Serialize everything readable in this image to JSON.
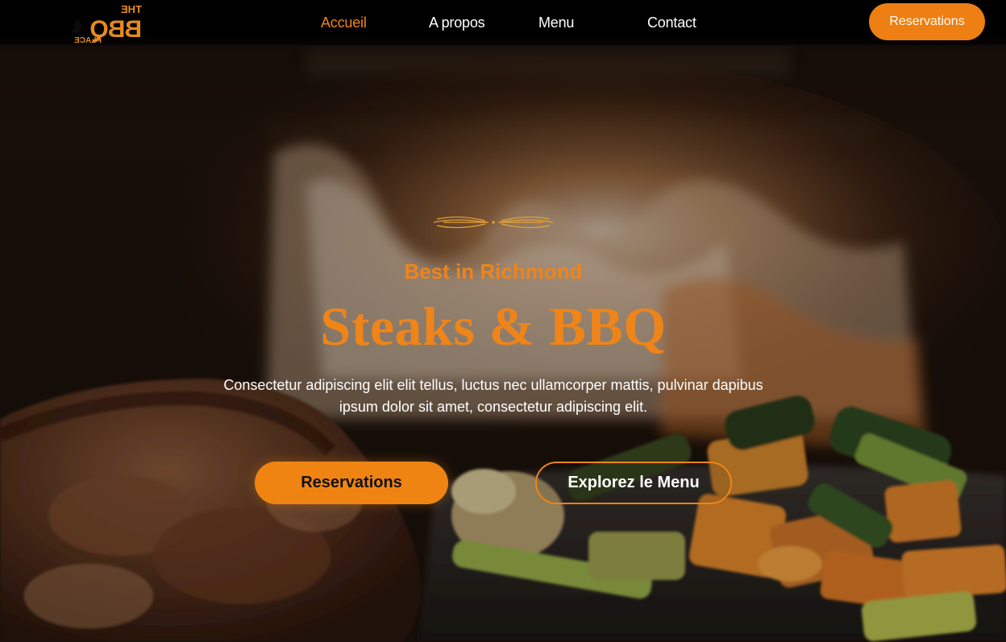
{
  "brand": {
    "logo_top": "THE",
    "logo_main": "BBQ",
    "logo_bottom": "PLACE",
    "accent_color": "#ef8419"
  },
  "nav": {
    "items": [
      {
        "label": "Accueil",
        "active": true
      },
      {
        "label": "A propos",
        "active": false
      },
      {
        "label": "Menu",
        "active": false
      },
      {
        "label": "Contact",
        "active": false
      }
    ],
    "cta_label": "Reservations"
  },
  "hero": {
    "ornament_icon": "flourish-divider-icon",
    "kicker": "Best in Richmond",
    "title": "Steaks & BBQ",
    "description": "Consectetur adipiscing elit elit tellus, luctus nec ullamcorper mattis, pulvinar dapibus ipsum dolor sit amet, consectetur adipiscing elit.",
    "primary_button": "Reservations",
    "secondary_button": "Explorez le Menu",
    "background": "grilled-steak-and-vegetables-with-flames-image"
  }
}
